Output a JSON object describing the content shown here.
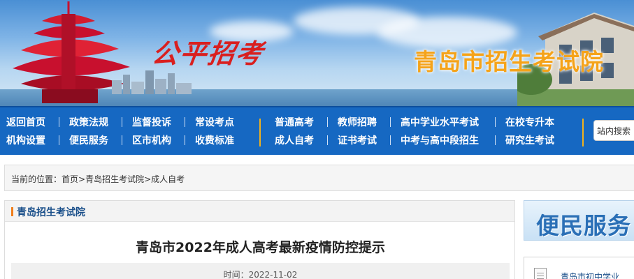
{
  "banner": {
    "seal_text": "公平招考",
    "site_title": "青岛市招生考试院"
  },
  "nav": {
    "row1": [
      "返回首页",
      "政策法规",
      "监督投诉",
      "常设考点",
      "普通高考",
      "教师招聘",
      "高中学业水平考试",
      "在校专升本"
    ],
    "row2": [
      "机构设置",
      "便民服务",
      "区市机构",
      "收费标准",
      "成人自考",
      "证书考试",
      "中考与高中段招生",
      "研究生考试"
    ],
    "search_label": "站内搜索"
  },
  "breadcrumb": {
    "prefix": "当前的位置：",
    "home": "首页",
    "sep1": ">",
    "section": "青岛招生考试院",
    "sep2": ">",
    "current": "成人自考"
  },
  "main": {
    "panel_title": "青岛招生考试院",
    "article_title": "青岛市2022年成人高考最新疫情防控提示",
    "time_label": "时间：",
    "time_value": "2022-11-02"
  },
  "sidebar": {
    "banner_text": "便民服务",
    "link_text": "青岛市初中学业"
  },
  "colors": {
    "nav_bg": "#1668c2",
    "site_title": "#f5a31a",
    "seal": "#d91f1f",
    "accent_bar": "#f07d1a"
  }
}
